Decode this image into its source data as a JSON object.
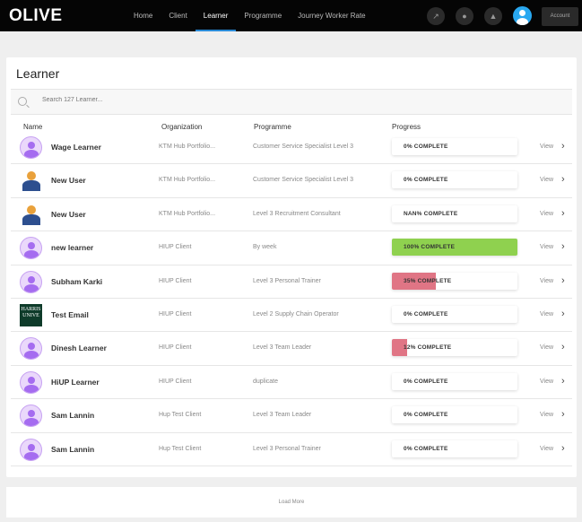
{
  "nav": {
    "logo": "OLIVE",
    "items": [
      {
        "label": "Home"
      },
      {
        "label": "Client"
      },
      {
        "label": "Learner",
        "active": true
      },
      {
        "label": "Programme"
      },
      {
        "label": "Journey Worker Rate"
      }
    ],
    "account": "Account",
    "icons": [
      "chart-icon",
      "chat-icon",
      "bell-icon",
      "user-avatar"
    ]
  },
  "page": {
    "title": "Learner",
    "search_placeholder": "Search 127 Learner...",
    "columns": {
      "name": "Name",
      "organization": "Organization",
      "programme": "Programme",
      "progress": "Progress"
    }
  },
  "colors": {
    "accent": "#2a8ad6",
    "complete": "#8fd14f",
    "partial": "#e07585"
  },
  "rows": [
    {
      "avatar": "purple",
      "name": "Wage Learner",
      "org": "KTM Hub Portfolio...",
      "programme": "Customer Service Specialist Level 3",
      "progress": 0,
      "label": "0% COMPLETE",
      "view": "View"
    },
    {
      "avatar": "user",
      "name": "New User",
      "org": "KTM Hub Portfolio...",
      "programme": "Customer Service Specialist Level 3",
      "progress": 0,
      "label": "0% COMPLETE",
      "view": "View"
    },
    {
      "avatar": "user",
      "name": "New User",
      "org": "KTM Hub Portfolio...",
      "programme": "Level 3 Recruitment Consultant",
      "progress": 0,
      "label": "NAN% COMPLETE",
      "view": "View"
    },
    {
      "avatar": "purple",
      "name": "new learner",
      "org": "HIUP Client",
      "programme": "By week",
      "progress": 100,
      "label": "100% COMPLETE",
      "view": "View"
    },
    {
      "avatar": "purple",
      "name": "Subham Karki",
      "org": "HIUP Client",
      "programme": "Level 3 Personal Trainer",
      "progress": 35,
      "label": "35% COMPLETE",
      "view": "View"
    },
    {
      "avatar": "logo",
      "logo_text": "HARRIS UNIVE",
      "name": "Test Email",
      "org": "HIUP Client",
      "programme": "Level 2 Supply Chain Operator",
      "progress": 0,
      "label": "0% COMPLETE",
      "view": "View"
    },
    {
      "avatar": "purple",
      "name": "Dinesh Learner",
      "org": "HIUP Client",
      "programme": "Level 3 Team Leader",
      "progress": 12,
      "label": "12% COMPLETE",
      "view": "View"
    },
    {
      "avatar": "purple",
      "name": "HiUP Learner",
      "org": "HIUP Client",
      "programme": "duplicate",
      "progress": 0,
      "label": "0% COMPLETE",
      "view": "View"
    },
    {
      "avatar": "purple",
      "name": "Sam Lannin",
      "org": "Hup Test Client",
      "programme": "Level 3 Team Leader",
      "progress": 0,
      "label": "0% COMPLETE",
      "view": "View"
    },
    {
      "avatar": "purple",
      "name": "Sam Lannin",
      "org": "Hup Test Client",
      "programme": "Level 3 Personal Trainer",
      "progress": 0,
      "label": "0% COMPLETE",
      "view": "View"
    }
  ],
  "load_more": "Load More"
}
